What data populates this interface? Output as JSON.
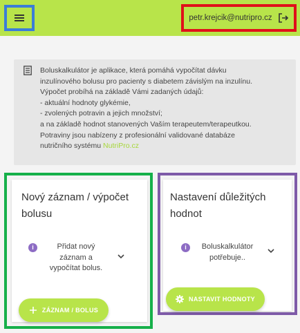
{
  "header": {
    "user_email": "petr.krejcik@nutripro.cz",
    "menu_icon": "hamburger-icon",
    "logout_icon": "logout-icon",
    "accent_color": "#b8e44a"
  },
  "info": {
    "icon": "document-list-icon",
    "lines": [
      "Boluskalkulátor je aplikace, která pomáhá vypočítat dávku",
      "inzulínového bolusu pro pacienty s diabetem závislým na inzulínu.",
      "Výpočet probíhá na základě Vámi zadaných údajů:",
      "- aktuální hodnoty glykémie,",
      "- zvolených potravin a jejich množství;",
      "a na základě hodnot stanovených Vaším terapeutem/terapeutkou.",
      "Potraviny jsou nabízeny z profesionální validované databáze"
    ],
    "last_line_prefix": "nutričního systému ",
    "link_text": "NutriPro.cz"
  },
  "cards": {
    "new_record": {
      "title": "Nový záznam / výpočet bolusu",
      "expand_label": "Přidat nový záznam a vypočítat bolus.",
      "button_label": "ZÁZNAM / BOLUS",
      "button_icon": "plus-icon"
    },
    "settings": {
      "title": "Nastavení důležitých hodnot",
      "expand_label": "Boluskalkulátor potřebuje..",
      "button_label": "NASTAVIT HODNOTY",
      "button_icon": "gear-icon"
    }
  },
  "colors": {
    "info_dot": "#8d6cc4",
    "link": "#a6d73a",
    "highlight_blue": "#3b7dd8",
    "highlight_red": "#e0101a",
    "highlight_green": "#16b04a",
    "highlight_purple": "#7e5ba8"
  }
}
